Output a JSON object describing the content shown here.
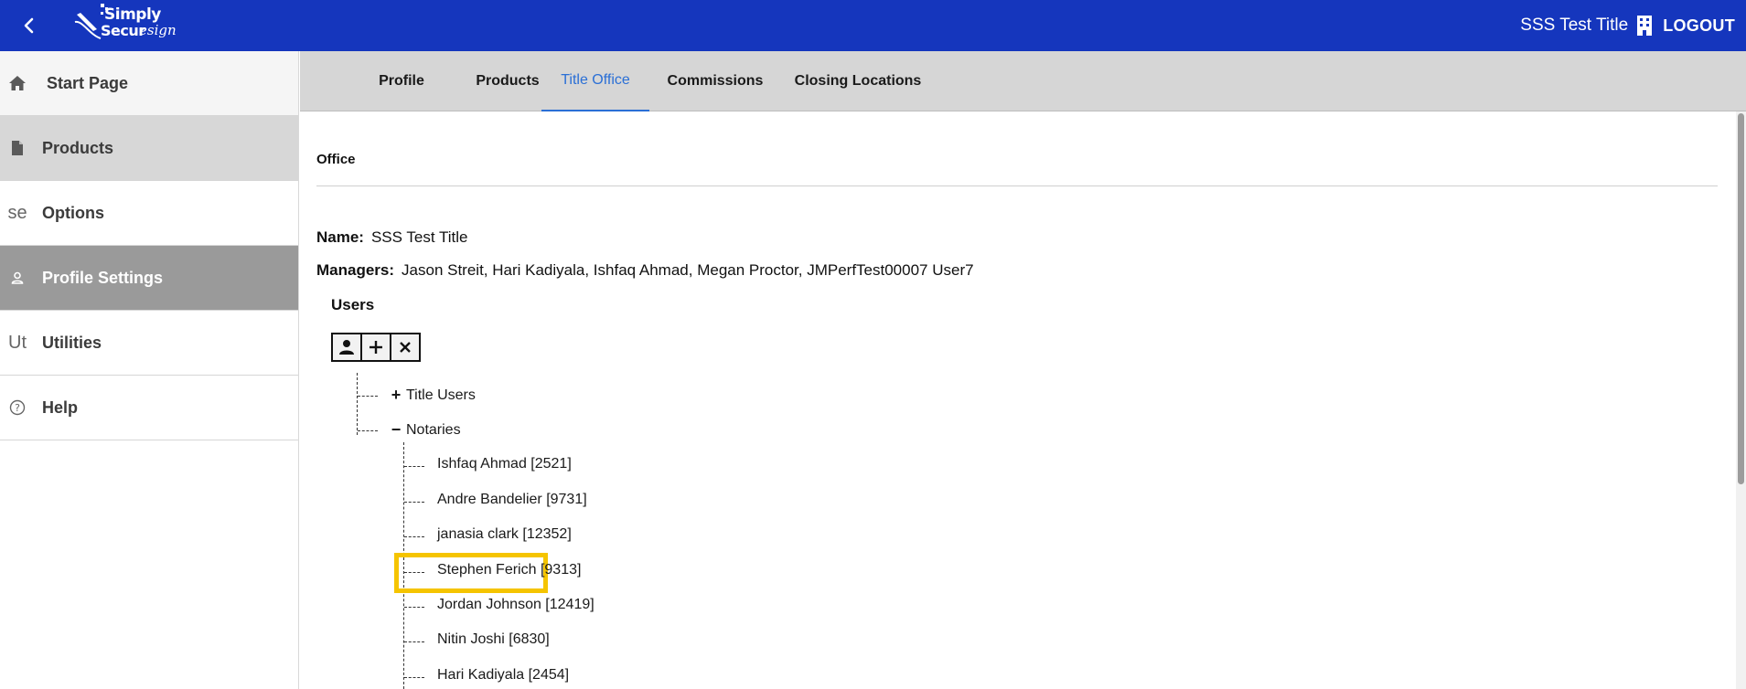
{
  "header": {
    "logo_text_1": "Simply",
    "logo_text_2": "Secur",
    "logo_script": "esign",
    "org_title": "SSS Test Title",
    "logout_label": "LOGOUT"
  },
  "sidebar": {
    "items": [
      {
        "label": "Start Page",
        "icon": "home-icon"
      },
      {
        "label": "Products",
        "icon": "document-icon"
      },
      {
        "label": "Options",
        "icon_text": "se"
      },
      {
        "label": "Profile Settings",
        "icon": "person-icon"
      },
      {
        "label": "Utilities",
        "icon_text": "Ut"
      },
      {
        "label": "Help",
        "icon": "help-circle-icon"
      }
    ]
  },
  "tabs": [
    {
      "label": "Profile"
    },
    {
      "label": "Products"
    },
    {
      "label": "Title Office",
      "active": true
    },
    {
      "label": "Commissions"
    },
    {
      "label": "Closing Locations"
    }
  ],
  "office": {
    "heading": "Office",
    "name_label": "Name:",
    "name_value": "SSS Test Title",
    "managers_label": "Managers:",
    "managers_value": "Jason Streit, Hari Kadiyala, Ishfaq Ahmad, Megan Proctor, JMPerfTest00007 User7",
    "users_heading": "Users"
  },
  "tree": {
    "groups": [
      {
        "label": "Title Users",
        "expanded": false
      },
      {
        "label": "Notaries",
        "expanded": true
      }
    ],
    "notaries": [
      "Ishfaq Ahmad [2521]",
      "Andre Bandelier [9731]",
      "janasia clark [12352]",
      "Stephen Ferich [9313]",
      "Jordan Johnson [12419]",
      "Nitin Joshi [6830]",
      "Hari Kadiyala [2454]"
    ],
    "highlighted": "Stephen Ferich [9313]"
  },
  "colors": {
    "header_bg": "#1536bd",
    "active_tab": "#2a6fd6",
    "highlight": "#f5c400",
    "sidebar_active": "#9a9a9a"
  }
}
